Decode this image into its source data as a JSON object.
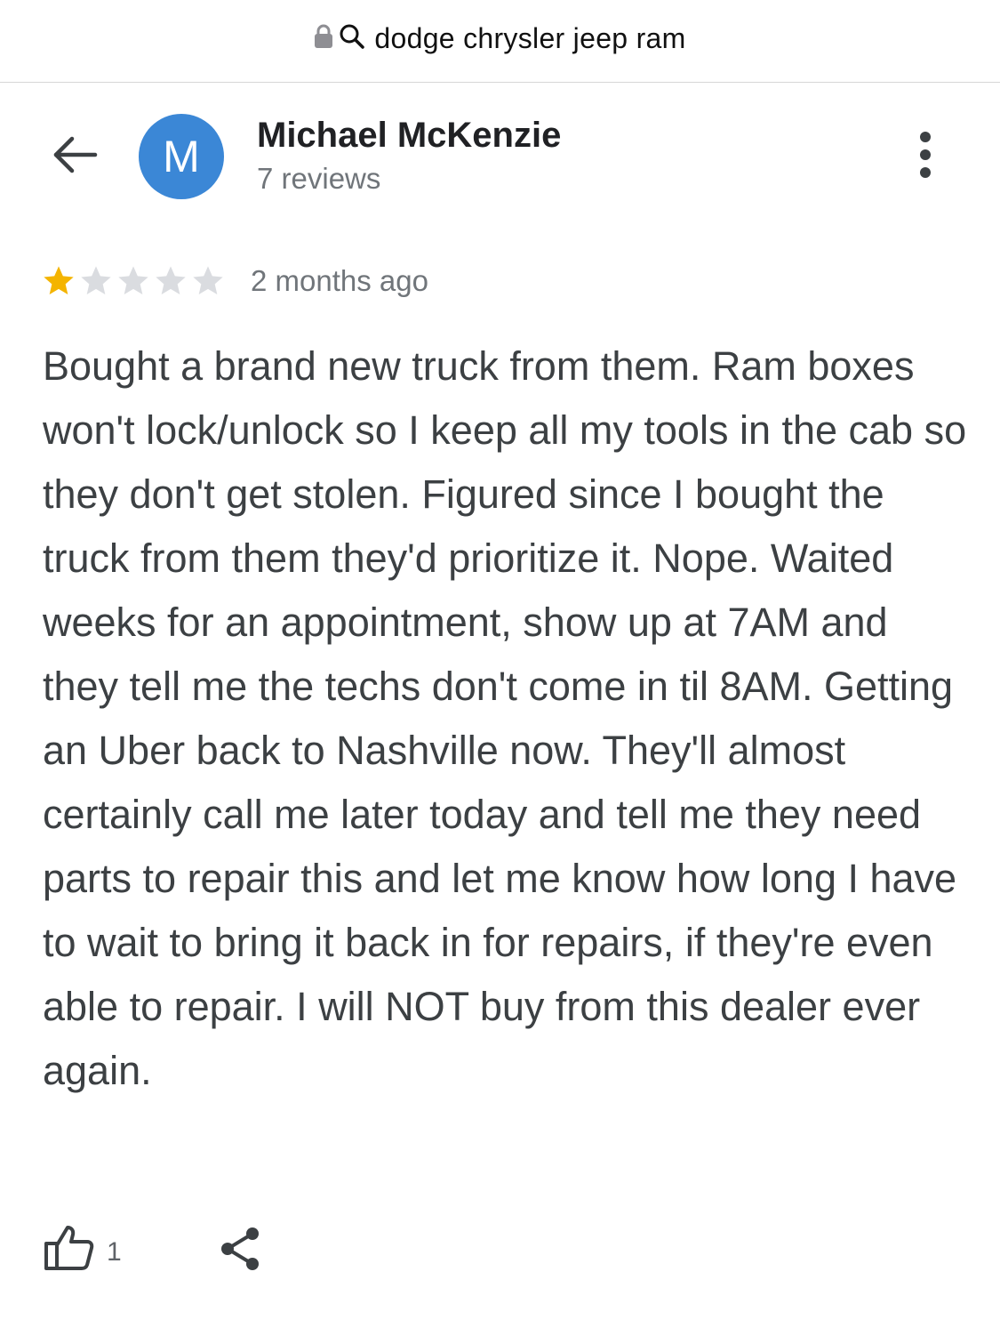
{
  "browser": {
    "url_text": "dodge chrysler jeep ram",
    "lock_icon": "lock-icon",
    "search_icon": "search-icon"
  },
  "header": {
    "back_icon": "arrow-left-icon",
    "avatar_letter": "M",
    "avatar_color": "#3b87d6",
    "author_name": "Michael McKenzie",
    "author_reviews": "7 reviews",
    "more_icon": "more-vertical-icon"
  },
  "review": {
    "rating": 1,
    "max_rating": 5,
    "star_filled_color": "#f4b400",
    "star_empty_color": "#dadce0",
    "date": "2 months ago",
    "text": "Bought a brand new truck from them. Ram boxes won't lock/unlock so I keep all my tools in the cab so they don't get stolen. Figured since I bought the truck from them they'd prioritize it. Nope. Waited weeks for an appointment, show up at 7AM and they tell me the techs don't come in til 8AM. Getting an Uber back to Nashville now. They'll almost certainly call me later today and tell me they need parts to repair this and let me know how long I have to wait to bring it back in for repairs, if they're even able to repair. I will NOT buy from this dealer ever again."
  },
  "actions": {
    "like_icon": "thumbs-up-icon",
    "like_count": "1",
    "share_icon": "share-icon"
  }
}
